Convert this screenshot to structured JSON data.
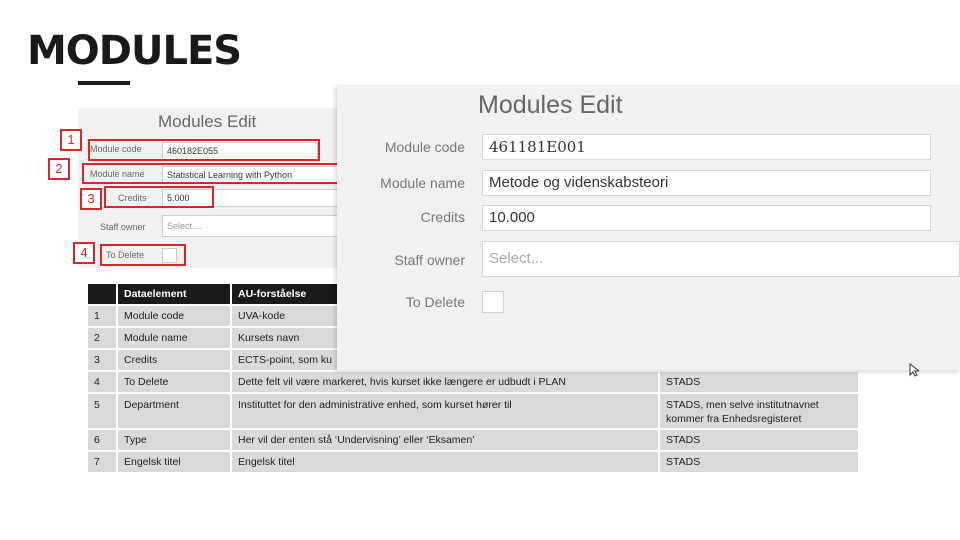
{
  "slide": {
    "title": "MODULES"
  },
  "bg_form": {
    "heading": "Modules Edit",
    "module_code_label": "Module code",
    "module_code_value": "460182E055",
    "module_name_label": "Module name",
    "module_name_value": "Statistical Learning with Python",
    "credits_label": "Credits",
    "credits_value": "5.000",
    "staff_owner_label": "Staff owner",
    "staff_owner_placeholder": "Select....",
    "to_delete_label": "To Delete"
  },
  "markers": [
    "1",
    "2",
    "3",
    "4"
  ],
  "table": {
    "headers": [
      "",
      "Dataelement",
      "AU-forståelse"
    ],
    "rows": [
      {
        "no": "1",
        "element": "Module code",
        "meaning": "UVA-kode",
        "source": ""
      },
      {
        "no": "2",
        "element": "Module name",
        "meaning": "Kursets navn",
        "source": ""
      },
      {
        "no": "3",
        "element": "Credits",
        "meaning": "ECTS-point, som ku",
        "source": ""
      },
      {
        "no": "4",
        "element": "To Delete",
        "meaning": "Dette felt vil være markeret, hvis kurset  ikke længere er udbudt i PLAN",
        "source": "STADS"
      },
      {
        "no": "5",
        "element": "Department",
        "meaning": "Instituttet for den administrative  enhed, som kurset hører til",
        "source": "STADS, men selve institutnavnet kommer fra Enhedsregisteret"
      },
      {
        "no": "6",
        "element": "Type",
        "meaning": "Her vil der enten stå ‘Undervisning’ eller ‘Eksamen’",
        "source": "STADS"
      },
      {
        "no": "7",
        "element": "Engelsk titel",
        "meaning": "Engelsk titel",
        "source": "STADS"
      }
    ]
  },
  "fg_form": {
    "heading": "Modules Edit",
    "module_code_label": "Module code",
    "module_code_value": "461181E001",
    "module_name_label": "Module name",
    "module_name_value": "Metode og videnskabsteori",
    "credits_label": "Credits",
    "credits_value": "10.000",
    "staff_owner_label": "Staff owner",
    "staff_owner_placeholder": "Select...",
    "to_delete_label": "To Delete"
  },
  "colors": {
    "highlight": "#d9262b",
    "header_bg": "#1a1a1a",
    "row_bg": "#d9d9d9",
    "form_bg": "#f1f1f1"
  }
}
